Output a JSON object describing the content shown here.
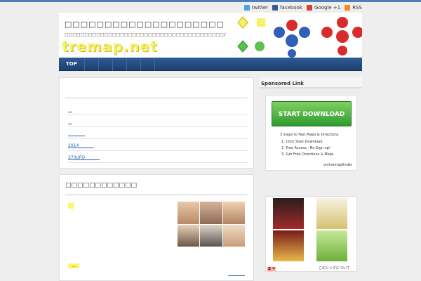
{
  "social": [
    {
      "icon": "twitter-icon",
      "label": "twitter",
      "color": "#4aa3df"
    },
    {
      "icon": "facebook-icon",
      "label": "facebook",
      "color": "#3b5998"
    },
    {
      "icon": "google-plus-icon",
      "label": "Google +1",
      "color": "#d44132"
    },
    {
      "icon": "rss-icon",
      "label": "RSS",
      "color": "#f48b1b"
    }
  ],
  "header": {
    "title": "□□□□□□□□□□□□□□□□□□□□",
    "description": "□□□□□□□□□□□□□□□□□□□□□□□□□□□□□□□□□□□□□□□□♪",
    "logo_text": "tremap.net"
  },
  "nav": {
    "top_label": "TOP"
  },
  "posts": {
    "items": [
      "__",
      "__",
      "________",
      "2014_______",
      "370UFO_______"
    ]
  },
  "section2": {
    "heading": "□□□□□□□□□□□□",
    "more_label": "..."
  },
  "sidebar": {
    "sponsored_label": "Sponsored Link",
    "ad1": {
      "button_label": "START DOWNLOAD",
      "headline": "3 steps to Fast Maps & Directions",
      "steps": [
        "1. Click Start Download",
        "2. Free Access - No Sign up!",
        "3. Get Free Directions & Maps"
      ],
      "brand": "onlinemapfinder"
    },
    "ad2": {
      "brand": "楽天",
      "note": "このリンクについて"
    }
  }
}
